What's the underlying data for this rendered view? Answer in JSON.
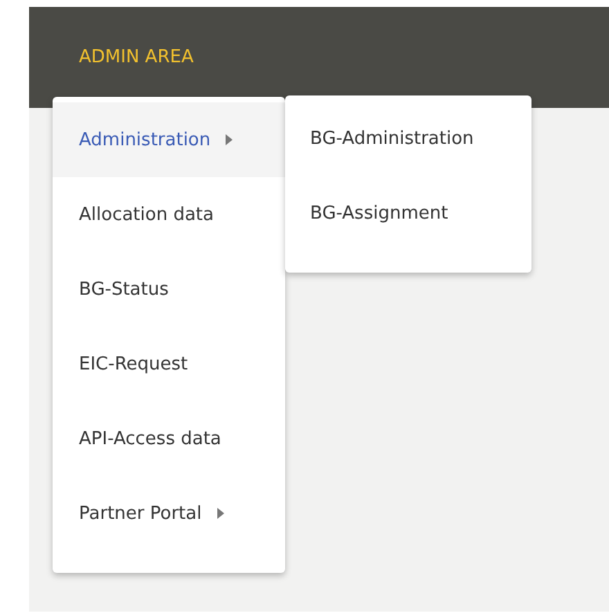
{
  "header": {
    "title": "ADMIN AREA"
  },
  "menu": [
    {
      "label": "Administration",
      "selected": true,
      "has_submenu": true
    },
    {
      "label": "Allocation data",
      "selected": false,
      "has_submenu": false
    },
    {
      "label": "BG-Status",
      "selected": false,
      "has_submenu": false
    },
    {
      "label": "EIC-Request",
      "selected": false,
      "has_submenu": false
    },
    {
      "label": "API-Access data",
      "selected": false,
      "has_submenu": false
    },
    {
      "label": "Partner Portal",
      "selected": false,
      "has_submenu": true
    }
  ],
  "submenu": [
    {
      "label": "BG-Administration"
    },
    {
      "label": "BG-Assignment"
    }
  ]
}
